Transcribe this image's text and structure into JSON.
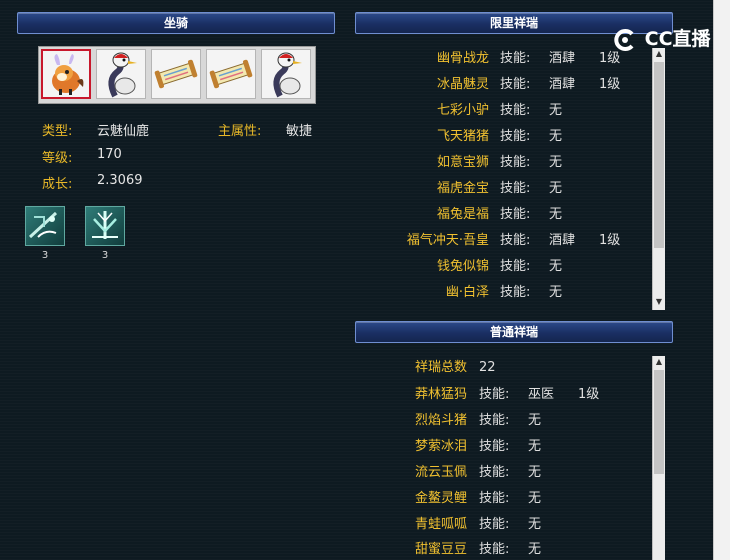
{
  "mount_panel": {
    "title": "坐骑",
    "pets": [
      {
        "icon": "deer-pet-icon",
        "selected": true
      },
      {
        "icon": "crane-pet-icon",
        "selected": false
      },
      {
        "icon": "scroll-pet-icon",
        "selected": false
      },
      {
        "icon": "scroll-pet-icon",
        "selected": false
      },
      {
        "icon": "crane-pet-icon",
        "selected": false
      }
    ],
    "type_label": "类型:",
    "type_value": "云魅仙鹿",
    "attr_label": "主属性:",
    "attr_value": "敏捷",
    "level_label": "等级:",
    "level_value": "170",
    "growth_label": "成长:",
    "growth_value": "2.3069",
    "skills": [
      {
        "icon": "skill-rune-icon",
        "level": "3"
      },
      {
        "icon": "skill-spike-icon",
        "level": "3"
      }
    ]
  },
  "limited_panel": {
    "title": "限里祥瑞",
    "rows": [
      {
        "name": "幽骨战龙",
        "skill_label": "技能:",
        "skill": "酒肆",
        "level": "1级"
      },
      {
        "name": "冰晶魅灵",
        "skill_label": "技能:",
        "skill": "酒肆",
        "level": "1级"
      },
      {
        "name": "七彩小驴",
        "skill_label": "技能:",
        "skill": "无",
        "level": ""
      },
      {
        "name": "飞天猪猪",
        "skill_label": "技能:",
        "skill": "无",
        "level": ""
      },
      {
        "name": "如意宝狮",
        "skill_label": "技能:",
        "skill": "无",
        "level": ""
      },
      {
        "name": "福虎金宝",
        "skill_label": "技能:",
        "skill": "无",
        "level": ""
      },
      {
        "name": "福兔是福",
        "skill_label": "技能:",
        "skill": "无",
        "level": ""
      },
      {
        "name": "福气冲天·吾皇",
        "skill_label": "技能:",
        "skill": "酒肆",
        "level": "1级"
      },
      {
        "name": "钱兔似锦",
        "skill_label": "技能:",
        "skill": "无",
        "level": ""
      },
      {
        "name": "幽·白泽",
        "skill_label": "技能:",
        "skill": "无",
        "level": ""
      }
    ]
  },
  "normal_panel": {
    "title": "普通祥瑞",
    "total_label": "祥瑞总数",
    "total_value": "22",
    "rows": [
      {
        "name": "莽林猛犸",
        "skill_label": "技能:",
        "skill": "巫医",
        "level": "1级"
      },
      {
        "name": "烈焰斗猪",
        "skill_label": "技能:",
        "skill": "无",
        "level": ""
      },
      {
        "name": "梦萦冰泪",
        "skill_label": "技能:",
        "skill": "无",
        "level": ""
      },
      {
        "name": "流云玉佩",
        "skill_label": "技能:",
        "skill": "无",
        "level": ""
      },
      {
        "name": "金鳌灵鲤",
        "skill_label": "技能:",
        "skill": "无",
        "level": ""
      },
      {
        "name": "青蛙呱呱",
        "skill_label": "技能:",
        "skill": "无",
        "level": ""
      },
      {
        "name": "甜蜜豆豆",
        "skill_label": "技能:",
        "skill": "无",
        "level": ""
      }
    ]
  },
  "watermark": {
    "text": "CC直播"
  },
  "colors": {
    "accent_gold": "#f0c030",
    "header_blue": "#1a2f63",
    "background": "#0e1a21"
  }
}
